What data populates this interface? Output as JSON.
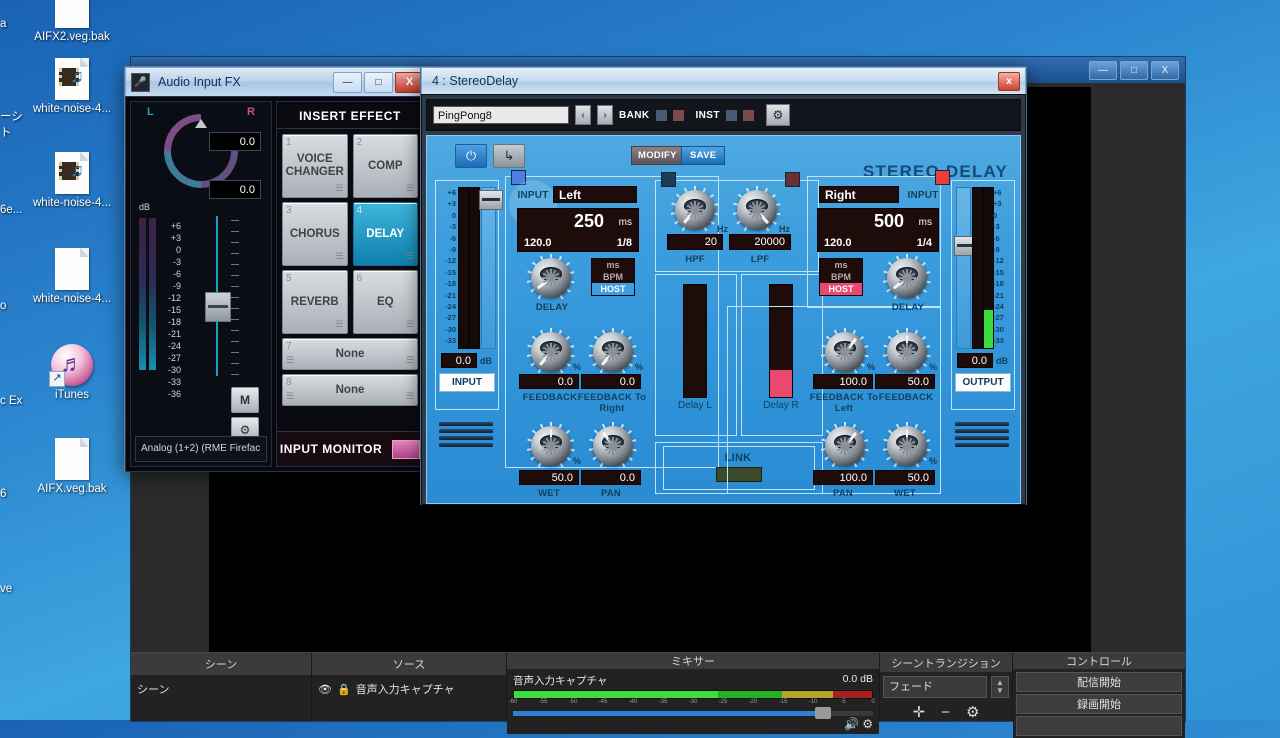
{
  "desktop": {
    "icons": [
      {
        "name": "AIFX2.veg.bak",
        "type": "doc"
      },
      {
        "name": "white-noise-4...",
        "type": "media"
      },
      {
        "name": "white-noise-4...",
        "type": "media"
      },
      {
        "name": "white-noise-4...",
        "type": "doc"
      },
      {
        "name": "iTunes",
        "type": "itunes"
      },
      {
        "name": "AIFX.veg.bak",
        "type": "doc"
      }
    ],
    "edge_labels": [
      "a",
      "ーシ",
      "ト",
      "6e...",
      "o",
      "c Ex",
      "6",
      "ve"
    ]
  },
  "obs": {
    "window_buttons": [
      "—",
      "□",
      "X"
    ],
    "docks": {
      "scenes": {
        "title": "シーン",
        "items": [
          "シーン"
        ]
      },
      "sources": {
        "title": "ソース",
        "items": [
          "音声入力キャプチャ"
        ],
        "eye_icon": "eye-icon",
        "lock_icon": "lock-icon"
      },
      "mixer": {
        "title": "ミキサー",
        "channel": "音声入力キャプチャ",
        "level_db": "0.0 dB",
        "ticks": [
          "-60",
          "-55",
          "-50",
          "-45",
          "-40",
          "-35",
          "-30",
          "-25",
          "-20",
          "-15",
          "-10",
          "-5",
          "0"
        ],
        "volume_percent": 86,
        "mute_icon": "speaker-icon",
        "settings_icon": "gear-icon"
      },
      "transitions": {
        "title": "シーントランジション",
        "selected": "フェード",
        "add_icon": "plus-icon",
        "remove_icon": "minus-icon",
        "config_icon": "gear-icon"
      },
      "controls": {
        "title": "コントロール",
        "buttons": [
          "配信開始",
          "録画開始",
          ""
        ]
      }
    }
  },
  "audio_input_fx": {
    "title": "Audio Input FX",
    "icon": "mic-icon",
    "window_buttons": [
      "—",
      "□",
      "X"
    ],
    "pan": {
      "left_label": "L",
      "right_label": "R",
      "value": "0.0"
    },
    "gain_value": "0.0",
    "db_label": "dB",
    "scale": [
      "+6",
      "+3",
      "0",
      "-3",
      "-6",
      "-9",
      "-12",
      "-15",
      "-18",
      "-21",
      "-24",
      "-27",
      "-30",
      "-33",
      "-36"
    ],
    "mute_button": "M",
    "settings_icon": "gear-icon",
    "device": "Analog (1+2) (RME Firefac",
    "insert_effect_header": "INSERT EFFECT",
    "slots": [
      {
        "num": "1",
        "label": "VOICE CHANGER",
        "active": false
      },
      {
        "num": "2",
        "label": "COMP",
        "active": false
      },
      {
        "num": "3",
        "label": "CHORUS",
        "active": false
      },
      {
        "num": "4",
        "label": "DELAY",
        "active": true
      },
      {
        "num": "5",
        "label": "REVERB",
        "active": false
      },
      {
        "num": "6",
        "label": "EQ",
        "active": false
      },
      {
        "num": "7",
        "label": "None",
        "active": false
      },
      {
        "num": "8",
        "label": "None",
        "active": false
      }
    ],
    "input_monitor_label": "INPUT MONITOR"
  },
  "stereo_delay": {
    "title": "4 : StereoDelay",
    "close_label": "x",
    "preset_name": "PingPong8",
    "prev_label": "‹",
    "next_label": "›",
    "bank_label": "BANK",
    "inst_label": "INST",
    "gear_icon": "gear-icon",
    "power_icon": "power-icon",
    "route_icon": "routing-icon",
    "modify_label": "MODIFY",
    "save_label": "SAVE",
    "plugin_title": "STEREO DELAY",
    "input_meter": {
      "scale": [
        "+6",
        "+3",
        "0",
        "-3",
        "-6",
        "-9",
        "-12",
        "-15",
        "-18",
        "-21",
        "-24",
        "-27",
        "-30",
        "-33"
      ],
      "value": "0.0",
      "unit": "dB",
      "label": "INPUT"
    },
    "output_meter": {
      "scale": [
        "+6",
        "+3",
        "0",
        "-3",
        "-6",
        "-9",
        "-12",
        "-15",
        "-18",
        "-21",
        "-24",
        "-27",
        "-30",
        "-33"
      ],
      "value": "0.0",
      "unit": "dB",
      "label": "OUTPUT"
    },
    "left": {
      "input_label": "INPUT",
      "channel": "Left",
      "time_value": "250",
      "time_unit": "ms",
      "bpm": "120.0",
      "note": "1/8",
      "mode": {
        "ms": "ms",
        "bpm": "BPM",
        "host": "HOST",
        "selected": "HOST"
      },
      "delay_label": "DELAY",
      "feedback_label": "FEEDBACK",
      "feedback_value": "0.0",
      "feedback_to_label": "FEEDBACK To Right",
      "feedback_to_value": "0.0",
      "wet_label": "WET",
      "wet_value": "50.0",
      "pan_label": "PAN",
      "pan_value": "0.0",
      "percent": "%"
    },
    "right": {
      "input_label": "INPUT",
      "channel": "Right",
      "time_value": "500",
      "time_unit": "ms",
      "bpm": "120.0",
      "note": "1/4",
      "mode": {
        "ms": "ms",
        "bpm": "BPM",
        "host": "HOST",
        "selected": "HOST"
      },
      "delay_label": "DELAY",
      "feedback_to_label": "FEEDBACK To Left",
      "feedback_to_value": "100.0",
      "feedback_label": "FEEDBACK",
      "feedback_value": "50.0",
      "pan_label": "PAN",
      "pan_value": "100.0",
      "wet_label": "WET",
      "wet_value": "50.0",
      "percent": "%"
    },
    "filters": {
      "hpf_label": "HPF",
      "hpf_value": "20",
      "hpf_unit": "Hz",
      "lpf_label": "LPF",
      "lpf_value": "20000",
      "lpf_unit": "Hz"
    },
    "delay_meters": {
      "left_label": "Delay L",
      "right_label": "Delay R",
      "left_level": 0,
      "right_level": 24
    },
    "link_label": "LINK"
  },
  "colors": {
    "accent_blue": "#3f9ee0",
    "plugin_bg": "#3c9ddd",
    "lcd_bg": "#1d0c0a",
    "active_slot": "#0f7fae",
    "meter_red": "#e9486f",
    "meter_green": "#3ddc3d"
  }
}
